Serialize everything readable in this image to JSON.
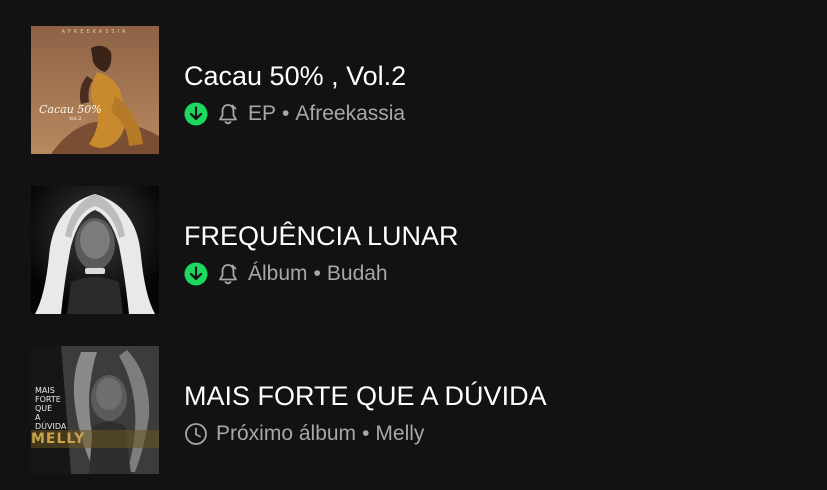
{
  "colors": {
    "background": "#121212",
    "title_text": "#ffffff",
    "meta_text": "#a7a7a7",
    "download_accent": "#1ed760"
  },
  "separator": "•",
  "items": [
    {
      "title": "Cacau 50% , Vol.2",
      "type": "EP",
      "artist": "Afreekassia",
      "downloaded": true,
      "icons": [
        "download-complete-icon",
        "bell-icon"
      ],
      "cover": {
        "artist_text": "AFREEKASSIA",
        "title_text": "Cacau 50%",
        "vol_text": "Vol.2",
        "palette": [
          "#8a5a3a",
          "#b98254",
          "#d49a3a"
        ]
      }
    },
    {
      "title": "FREQUÊNCIA LUNAR",
      "type": "Álbum",
      "artist": "Budah",
      "downloaded": true,
      "icons": [
        "download-complete-icon",
        "bell-icon"
      ],
      "cover": {
        "palette": [
          "#0a0a0a",
          "#d8d8d8",
          "#f5f5f5"
        ]
      }
    },
    {
      "title": "MAIS FORTE QUE A DÚVIDA",
      "type": "Próximo álbum",
      "artist": "Melly",
      "downloaded": false,
      "icons": [
        "clock-icon"
      ],
      "cover": {
        "side_text": "MAIS\nFORTE\nQUE\nA\nDÚVIDA",
        "gold_text": "MELLY",
        "palette": [
          "#1a1a1a",
          "#6b6b6b",
          "#c9a24a"
        ]
      }
    }
  ]
}
